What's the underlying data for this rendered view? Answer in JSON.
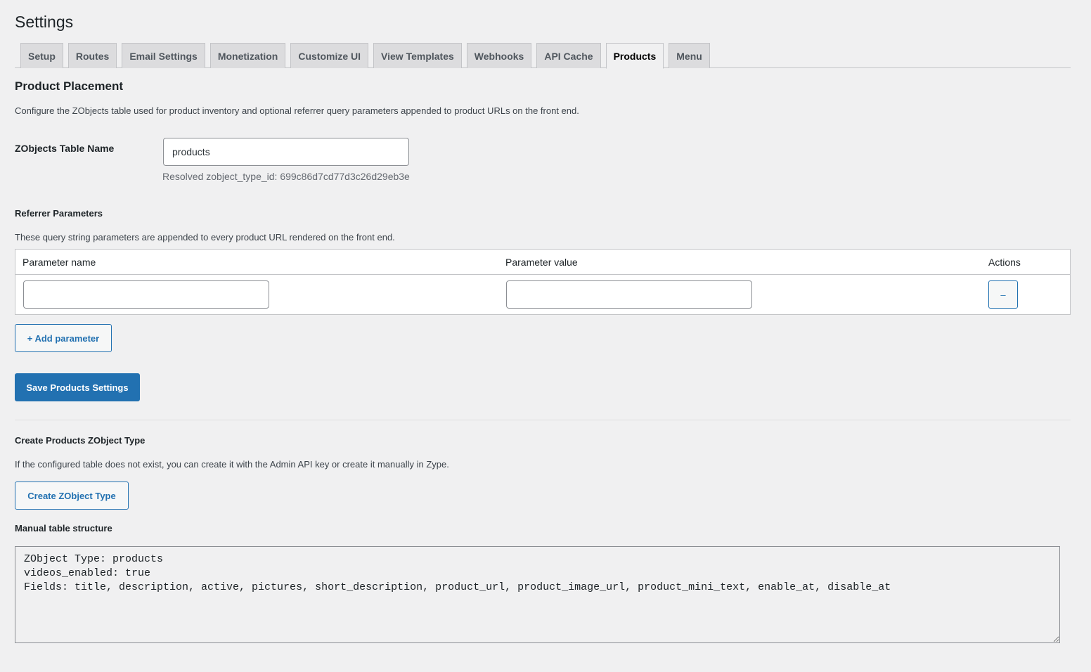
{
  "page_title": "Settings",
  "tabs": [
    {
      "label": "Setup",
      "active": false
    },
    {
      "label": "Routes",
      "active": false
    },
    {
      "label": "Email Settings",
      "active": false
    },
    {
      "label": "Monetization",
      "active": false
    },
    {
      "label": "Customize UI",
      "active": false
    },
    {
      "label": "View Templates",
      "active": false
    },
    {
      "label": "Webhooks",
      "active": false
    },
    {
      "label": "API Cache",
      "active": false
    },
    {
      "label": "Products",
      "active": true
    },
    {
      "label": "Menu",
      "active": false
    }
  ],
  "product_placement": {
    "heading": "Product Placement",
    "description": "Configure the ZObjects table used for product inventory and optional referrer query parameters appended to product URLs on the front end.",
    "table_name_label": "ZObjects Table Name",
    "table_name_value": "products",
    "resolved_text": "Resolved zobject_type_id: 699c86d7cd77d3c26d29eb3e"
  },
  "referrer": {
    "heading": "Referrer Parameters",
    "description": "These query string parameters are appended to every product URL rendered on the front end.",
    "columns": [
      "Parameter name",
      "Parameter value",
      "Actions"
    ],
    "rows": [
      {
        "name": "",
        "value": "",
        "remove_label": "–"
      }
    ],
    "add_label": "+ Add parameter"
  },
  "save_label": "Save Products Settings",
  "create_section": {
    "heading": "Create Products ZObject Type",
    "description": "If the configured table does not exist, you can create it with the Admin API key or create it manually in Zype.",
    "button_label": "Create ZObject Type",
    "manual_heading": "Manual table structure",
    "manual_structure": "ZObject Type: products\nvideos_enabled: true\nFields: title, description, active, pictures, short_description, product_url, product_image_url, product_mini_text, enable_at, disable_at"
  },
  "colors": {
    "accent": "#2271b1",
    "background": "#f0f0f1"
  }
}
